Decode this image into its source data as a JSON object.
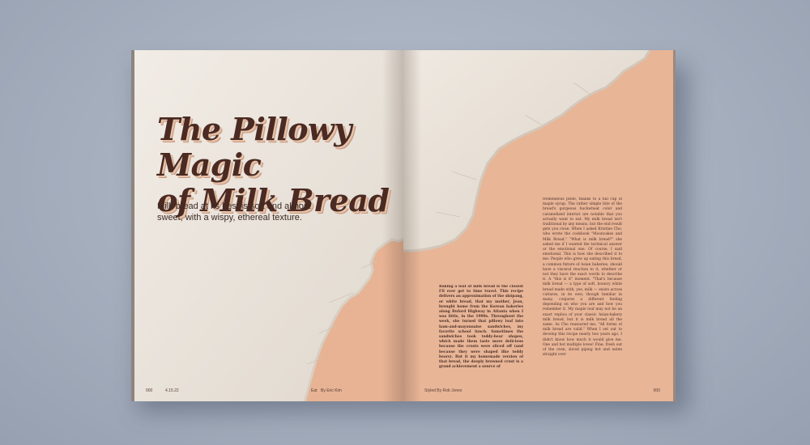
{
  "article": {
    "title_line1": "The Pillowy Magic",
    "title_line2": "of Milk Bread",
    "deck": "Milk bread at its best is soft and almost sweet, with a wispy, ethereal texture.",
    "byline": "By Eric Kim"
  },
  "left_page": {
    "folio_number": "000",
    "folio_section": "4.15.22",
    "folio_brand": "Eat"
  },
  "right_page": {
    "photo_credit": "Styled By Rob Jones",
    "folio_number": "000",
    "column1": "Baking a loaf of milk bread is the closest I'll ever get to time travel. This recipe delivers an approximation of the shōpang, or white bread, that my mother, Jean, brought home from the Korean bakeries along Buford Highway in Atlanta when I was little, in the 1990s. Throughout the week, she turned that pillowy loaf into ham-and-mayonnaise sandwiches, my favorite school lunch. Sometimes the sandwiches took teddy-bear shapes, which made them taste more delicious because the crusts were sliced off (and because they were shaped like teddy bears). But it my homemade version of that bread, the deeply browned crust is a grand achievement a source of",
    "column2": "tremendous pride, thanks to a full cup of maple syrup. The rather simple bite of the bread's gorgeous buckwheat color and caramelized interior are notable that you actually want to eat. My milk bread isn't traditional by any means, but the end result gets you close. When I asked Kristine Cho, who wrote the cookbook \"Mooncakes and Milk Bread,\" \"What is milk bread?\" she asked me if I wanted the technical answer or the emotional one. Of course, I said emotional. This is how she described it to me: People who grew up eating this bread, a common fixture of Asian bakeries, should have a visceral reaction to it, whether or not they have the exact words to describe it. A \"this is it\" moment. \"That's because milk bread — a type of soft, bouncy white bread made with, yes, milk — exists across cultures, in its own, though familiar in many, conjures a different feeling depending on who you are and how you remember it. My maple loaf may not be an exact replica of your classic Asian-bakery milk bread, but it is milk bread all the same. As Cho reassured me, \"All forms of milk bread are valid.\" When I set out to develop this recipe nearly two years ago, I didn't know how much it would give me. One and hot multiple loves! Fine, fresh out of the oven, sliced piping hot and eaten straight over"
  },
  "colors": {
    "paper": "#ece6de",
    "peach": "#e8b597",
    "title_ink": "#4a2a22",
    "backdrop": "#a3adbc"
  }
}
